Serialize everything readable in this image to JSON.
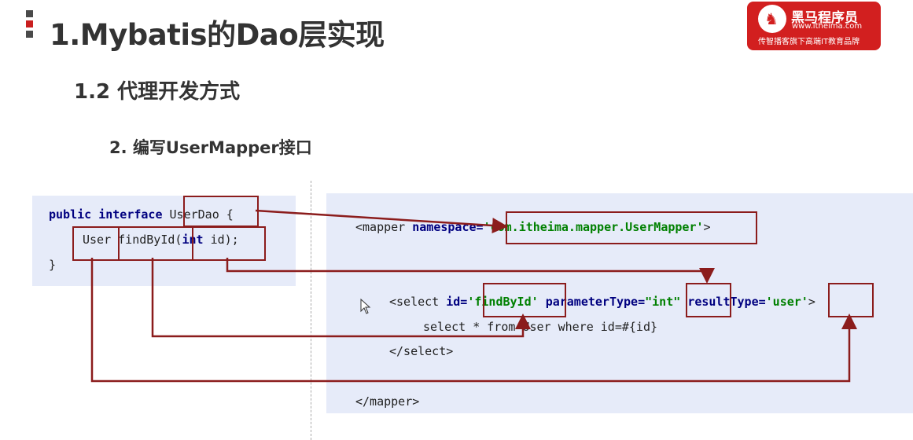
{
  "slide": {
    "title": "1.Mybatis的Dao层实现",
    "subtitle": "1.2 代理开发方式",
    "step": "2. 编写UserMapper接口"
  },
  "logo": {
    "name": "黑马程序员",
    "url": "www.itheima.com",
    "slogan": "传智播客旗下高端IT教育品牌"
  },
  "interface_code": {
    "line1_public": "public",
    "line1_interface": "interface",
    "line1_name": "UserDao",
    "line1_brace": "{",
    "line2_return": "User",
    "line2_method": "findById",
    "line2_paren": "(",
    "line2_int": "int",
    "line2_param": "id);",
    "line3": "}"
  },
  "mapper_code": {
    "mapper_open_tag": "<mapper",
    "namespace_attr": "namespace=",
    "namespace_value": "'com.itheima.mapper.UserMapper'",
    "mapper_open_end": ">",
    "select_open": "<select",
    "id_attr": "id=",
    "id_value": "'findById'",
    "param_attr": "parameterType=",
    "param_value": "\"int\"",
    "result_attr": "resultType=",
    "result_value": "'user'",
    "select_open_end": ">",
    "sql": "select * from User where id=#{id}",
    "select_close": "</select>",
    "mapper_close": "</mapper>"
  },
  "colors": {
    "highlight_box": "#8b1c1c",
    "keyword": "#000080",
    "string": "#008000",
    "panel_bg": "#e6ebf9"
  }
}
